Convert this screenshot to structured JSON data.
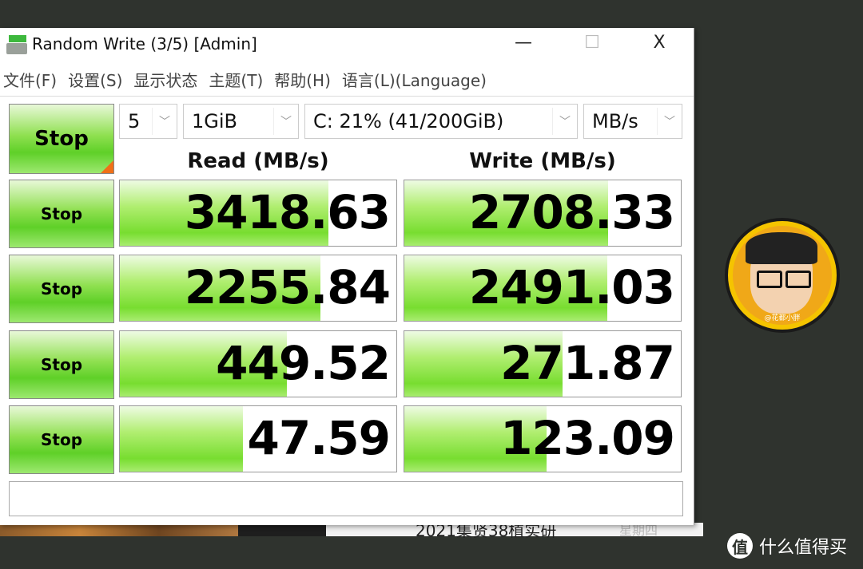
{
  "window": {
    "title": "Random Write (3/5) [Admin]",
    "minimize": "—",
    "maximize": "☐",
    "close": "X"
  },
  "menu": [
    "文件(F)",
    "设置(S)",
    "显示状态",
    "主题(T)",
    "帮助(H)",
    "语言(L)(Language)"
  ],
  "controls": {
    "main_button": "Stop",
    "count": "5",
    "size": "1GiB",
    "drive": "C: 21% (41/200GiB)",
    "unit": "MB/s"
  },
  "headers": {
    "read": "Read (MB/s)",
    "write": "Write (MB/s)"
  },
  "rows": [
    {
      "button": "Stop",
      "read": "3418.63",
      "read_fill": 0.755,
      "write": "2708.33",
      "write_fill": 0.738
    },
    {
      "button": "Stop",
      "read": "2255.84",
      "read_fill": 0.726,
      "write": "2491.03",
      "write_fill": 0.733
    },
    {
      "button": "Stop",
      "read": "449.52",
      "read_fill": 0.605,
      "write": "271.87",
      "write_fill": 0.572
    },
    {
      "button": "Stop",
      "read": "47.59",
      "read_fill": 0.444,
      "write": "123.09",
      "write_fill": 0.514
    }
  ],
  "status": "",
  "avatar_caption": "@花都小胖",
  "watermark": {
    "logo": "值",
    "text": "什么值得买"
  },
  "background_window": {
    "text": "2021集贤38植实研",
    "date": "星期四"
  },
  "colors": {
    "bar_green": "#78dd30",
    "accent_orange": "#f07018",
    "ring_yellow": "#f5c400"
  }
}
